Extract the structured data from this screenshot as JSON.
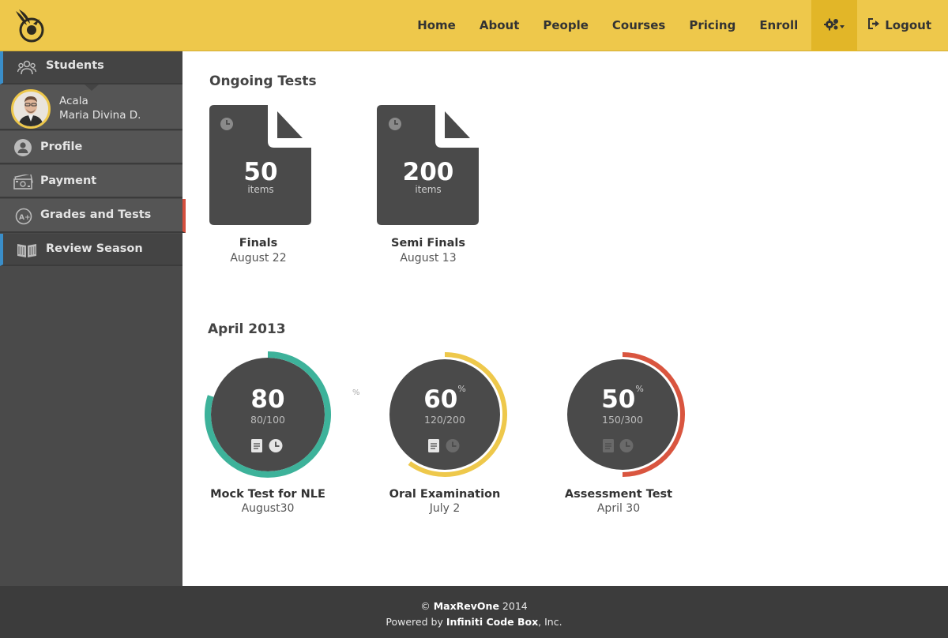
{
  "header": {
    "nav": [
      "Home",
      "About",
      "People",
      "Courses",
      "Pricing",
      "Enroll"
    ],
    "logout_label": "Logout",
    "accent": "#eec84b"
  },
  "sidebar": {
    "students_label": "Students",
    "user": {
      "first": "Acala",
      "last": "Maria Divina D."
    },
    "items": [
      {
        "label": "Profile",
        "icon": "user-icon"
      },
      {
        "label": "Payment",
        "icon": "money-icon"
      },
      {
        "label": "Grades and Tests",
        "icon": "grade-icon"
      },
      {
        "label": "Review Season",
        "icon": "book-icon"
      }
    ]
  },
  "ongoing": {
    "title": "Ongoing Tests",
    "tests": [
      {
        "count": "50",
        "unit": "items",
        "name": "Finals",
        "date": "August 22"
      },
      {
        "count": "200",
        "unit": "items",
        "name": "Semi Finals",
        "date": "August 13"
      }
    ]
  },
  "april": {
    "title": "April 2013",
    "stray_pct": "%",
    "results": [
      {
        "value": "80",
        "pct_sign": "",
        "score": "80/100",
        "fraction": 0.8,
        "color": "#3db29a",
        "name": "Mock Test for NLE",
        "date": "August30"
      },
      {
        "value": "60",
        "pct_sign": "%",
        "score": "120/200",
        "fraction": 0.6,
        "color": "#eec84b",
        "name": "Oral Examination",
        "date": "July 2"
      },
      {
        "value": "50",
        "pct_sign": "%",
        "score": "150/300",
        "fraction": 0.5,
        "color": "#d9553f",
        "name": "Assessment Test",
        "date": "April 30"
      }
    ]
  },
  "footer": {
    "copy": "©",
    "brand": "MaxRevOne",
    "year": "2014",
    "powered": "Powered by",
    "company": "Infiniti Code Box",
    "suffix": ", Inc."
  }
}
